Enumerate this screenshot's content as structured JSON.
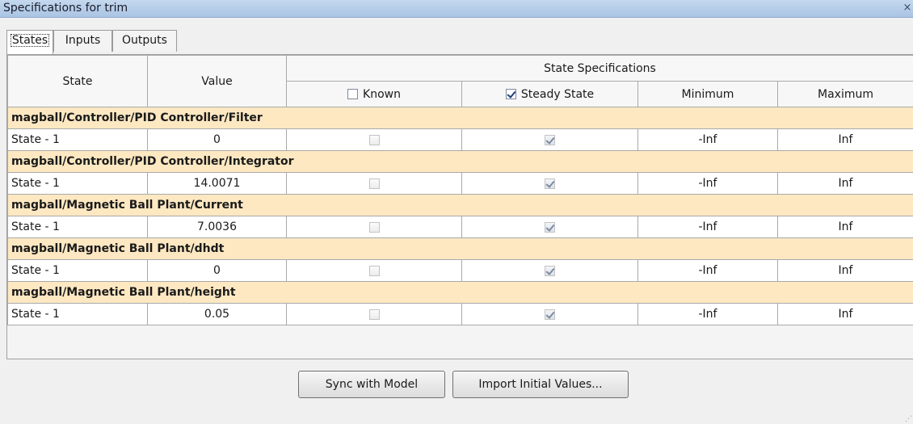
{
  "window": {
    "title": "Specifications for trim",
    "close_glyph": "×"
  },
  "tabs": [
    {
      "label": "States",
      "active": true
    },
    {
      "label": "Inputs",
      "active": false
    },
    {
      "label": "Outputs",
      "active": false
    }
  ],
  "table": {
    "headers": {
      "state": "State",
      "value": "Value",
      "group": "State Specifications",
      "known": "Known",
      "steady": "Steady State",
      "minimum": "Minimum",
      "maximum": "Maximum"
    },
    "header_checks": {
      "known": false,
      "steady": true
    },
    "groups": [
      {
        "block": "magball/Controller/PID Controller/Filter",
        "state": "State - 1",
        "value": "0",
        "known": false,
        "steady": true,
        "min": "-Inf",
        "max": "Inf"
      },
      {
        "block": "magball/Controller/PID Controller/Integrator",
        "state": "State - 1",
        "value": "14.0071",
        "known": false,
        "steady": true,
        "min": "-Inf",
        "max": "Inf"
      },
      {
        "block": "magball/Magnetic Ball Plant/Current",
        "state": "State - 1",
        "value": "7.0036",
        "known": false,
        "steady": true,
        "min": "-Inf",
        "max": "Inf"
      },
      {
        "block": "magball/Magnetic Ball Plant/dhdt",
        "state": "State - 1",
        "value": "0",
        "known": false,
        "steady": true,
        "min": "-Inf",
        "max": "Inf"
      },
      {
        "block": "magball/Magnetic Ball Plant/height",
        "state": "State - 1",
        "value": "0.05",
        "known": false,
        "steady": true,
        "min": "-Inf",
        "max": "Inf"
      }
    ]
  },
  "buttons": {
    "sync": "Sync with Model",
    "import": "Import Initial Values..."
  }
}
